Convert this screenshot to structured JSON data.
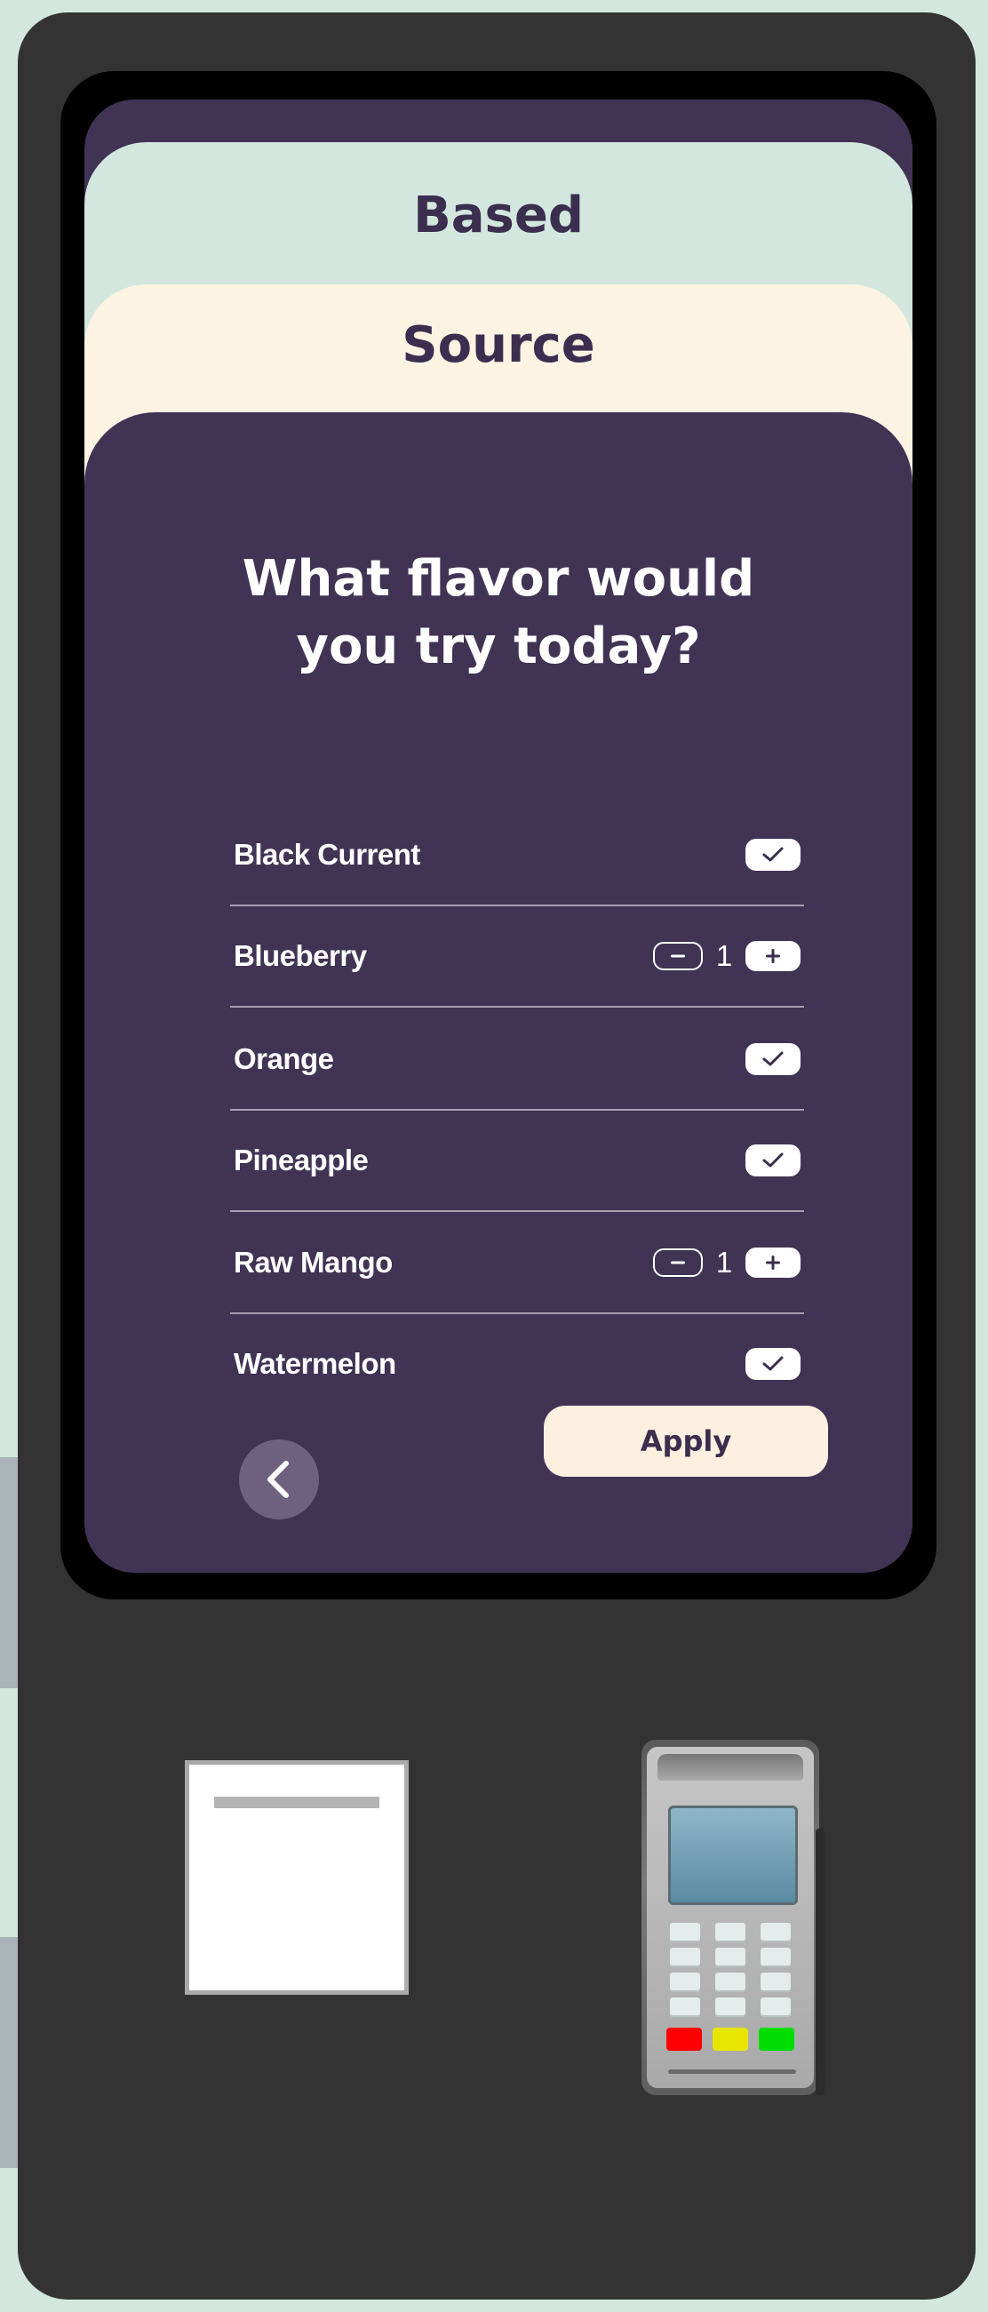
{
  "cards": {
    "based_title": "Based",
    "source_title": "Source"
  },
  "question": {
    "line1": "What flavor would",
    "line2": "you try today?"
  },
  "flavors": [
    {
      "label": "Black Current",
      "control": "checkbox",
      "checked": true
    },
    {
      "label": "Blueberry",
      "control": "stepper",
      "quantity": "1"
    },
    {
      "label": "Orange",
      "control": "checkbox",
      "checked": true
    },
    {
      "label": "Pineapple",
      "control": "checkbox",
      "checked": true
    },
    {
      "label": "Raw Mango",
      "control": "stepper",
      "quantity": "1"
    },
    {
      "label": "Watermelon",
      "control": "checkbox",
      "checked": true
    }
  ],
  "apply_label": "Apply",
  "colors": {
    "panel": "#413354",
    "accent_mint": "#d3e7de",
    "accent_cream": "#fdf3e3",
    "kiosk_body": "#333333"
  },
  "icons": {
    "checkmark": "check-icon",
    "minus": "minus-icon",
    "plus": "plus-icon",
    "back": "chevron-left-icon"
  }
}
